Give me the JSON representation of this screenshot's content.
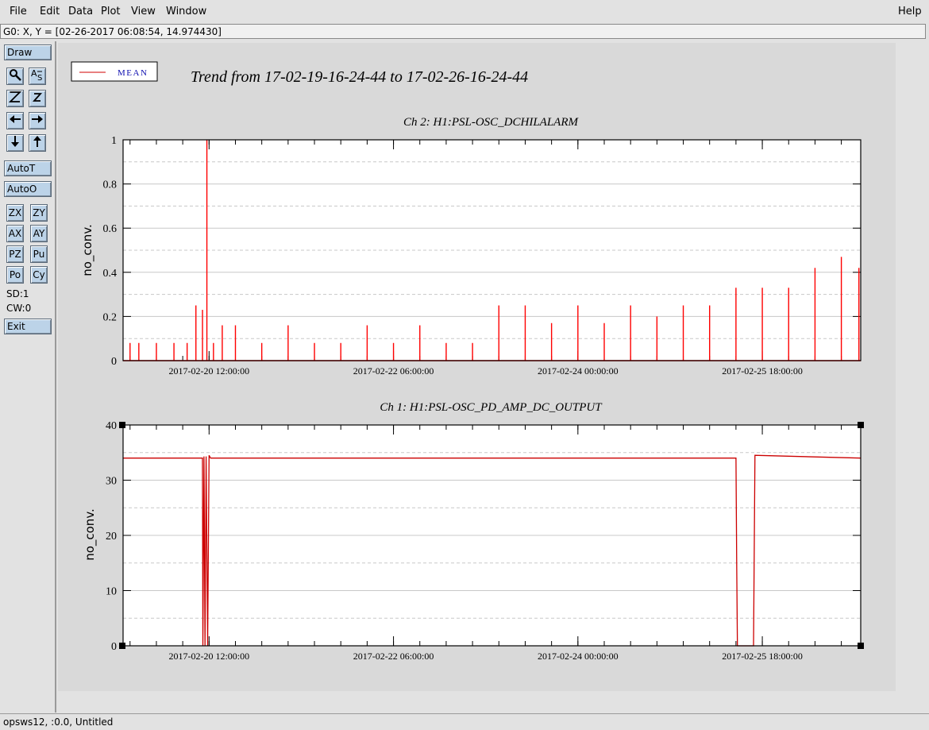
{
  "menu": {
    "file": "File",
    "edit": "Edit",
    "data": "Data",
    "plot": "Plot",
    "view": "View",
    "window": "Window",
    "help": "Help"
  },
  "coord_readout": "G0: X, Y = [02-26-2017 06:08:54, 14.974430]",
  "toolbar": {
    "draw": "Draw",
    "autot": "AutoT",
    "autoo": "AutoO",
    "zx": "ZX",
    "zy": "ZY",
    "ax": "AX",
    "ay": "AY",
    "pz": "PZ",
    "pu": "Pu",
    "po": "Po",
    "cy": "Cy",
    "sd": "SD:1",
    "cw": "CW:0",
    "exit": "Exit"
  },
  "status": "opsws12, :0.0, Untitled",
  "legend": {
    "label": "MEAN",
    "color": "#d00000"
  },
  "plot_title": "Trend from 17-02-19-16-24-44 to 17-02-26-16-24-44",
  "chart_data": [
    {
      "type": "line",
      "title": "Ch 2: H1:PSL-OSC_DCHILALARM",
      "ylabel": "no_conv.",
      "xlabel": "",
      "xlim": [
        "2017-02-19 16:24:44",
        "2017-02-26 16:24:44"
      ],
      "ylim": [
        0,
        1
      ],
      "yticks": [
        "0",
        "0.2",
        "0.4",
        "0.6",
        "0.8",
        "1"
      ],
      "xticks": [
        "2017-02-20 12:00:00",
        "2017-02-22 06:00:00",
        "2017-02-24 00:00:00",
        "2017-02-25 18:00:00"
      ],
      "grid": true,
      "series": [
        {
          "name": "MEAN",
          "color": "#ff0000",
          "x": [
            "2017-02-19 18:00",
            "2017-02-19 20:00",
            "2017-02-20 00:00",
            "2017-02-20 04:00",
            "2017-02-20 07:00",
            "2017-02-20 09:00",
            "2017-02-20 10:30",
            "2017-02-20 11:30",
            "2017-02-20 13:00",
            "2017-02-20 15:00",
            "2017-02-20 18:00",
            "2017-02-21 00:00",
            "2017-02-21 06:00",
            "2017-02-21 12:00",
            "2017-02-21 18:00",
            "2017-02-22 00:00",
            "2017-02-22 06:00",
            "2017-02-22 12:00",
            "2017-02-22 18:00",
            "2017-02-23 00:00",
            "2017-02-23 06:00",
            "2017-02-23 12:00",
            "2017-02-23 18:00",
            "2017-02-24 00:00",
            "2017-02-24 06:00",
            "2017-02-24 12:00",
            "2017-02-24 18:00",
            "2017-02-25 00:00",
            "2017-02-25 06:00",
            "2017-02-25 12:00",
            "2017-02-25 18:00",
            "2017-02-26 00:00",
            "2017-02-26 06:00",
            "2017-02-26 12:00",
            "2017-02-26 16:00"
          ],
          "values": [
            0.08,
            0.08,
            0.08,
            0.08,
            0.08,
            0.25,
            0.23,
            1.0,
            0.08,
            0.16,
            0.16,
            0.08,
            0.16,
            0.08,
            0.08,
            0.16,
            0.08,
            0.16,
            0.08,
            0.08,
            0.25,
            0.25,
            0.17,
            0.25,
            0.17,
            0.25,
            0.2,
            0.25,
            0.25,
            0.33,
            0.33,
            0.33,
            0.42,
            0.47,
            0.42
          ]
        }
      ]
    },
    {
      "type": "line",
      "title": "Ch 1: H1:PSL-OSC_PD_AMP_DC_OUTPUT",
      "ylabel": "no_conv.",
      "xlabel": "",
      "xlim": [
        "2017-02-19 16:24:44",
        "2017-02-26 16:24:44"
      ],
      "ylim": [
        0,
        40
      ],
      "yticks": [
        "0",
        "10",
        "20",
        "30",
        "40"
      ],
      "xticks": [
        "2017-02-20 12:00:00",
        "2017-02-22 06:00:00",
        "2017-02-24 00:00:00",
        "2017-02-25 18:00:00"
      ],
      "grid": true,
      "series": [
        {
          "name": "MEAN",
          "color": "#cc0000",
          "x": [
            "2017-02-19 16:25",
            "2017-02-20 10:30",
            "2017-02-20 10:35",
            "2017-02-20 10:50",
            "2017-02-20 11:05",
            "2017-02-20 11:20",
            "2017-02-20 11:40",
            "2017-02-20 12:00",
            "2017-02-20 12:20",
            "2017-02-20 13:00",
            "2017-02-25 12:00",
            "2017-02-25 12:10",
            "2017-02-25 12:20",
            "2017-02-25 16:00",
            "2017-02-25 16:20",
            "2017-02-26 16:24"
          ],
          "values": [
            34,
            34,
            0,
            34.3,
            0,
            34.3,
            0,
            34.5,
            34,
            34,
            34,
            15,
            0,
            0,
            34.5,
            34
          ]
        }
      ]
    }
  ]
}
